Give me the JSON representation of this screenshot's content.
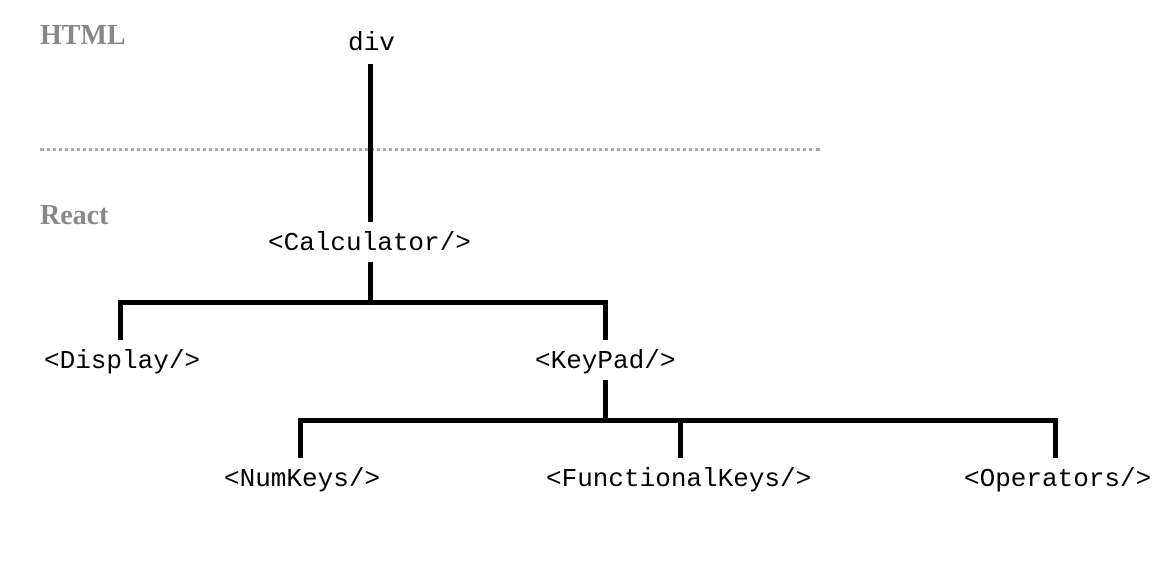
{
  "labels": {
    "html_section": "HTML",
    "react_section": "React"
  },
  "nodes": {
    "root": "div",
    "calculator": "<Calculator/>",
    "display": "<Display/>",
    "keypad": "<KeyPad/>",
    "numkeys": "<NumKeys/>",
    "functionalkeys": "<FunctionalKeys/>",
    "operators": "<Operators/>"
  }
}
